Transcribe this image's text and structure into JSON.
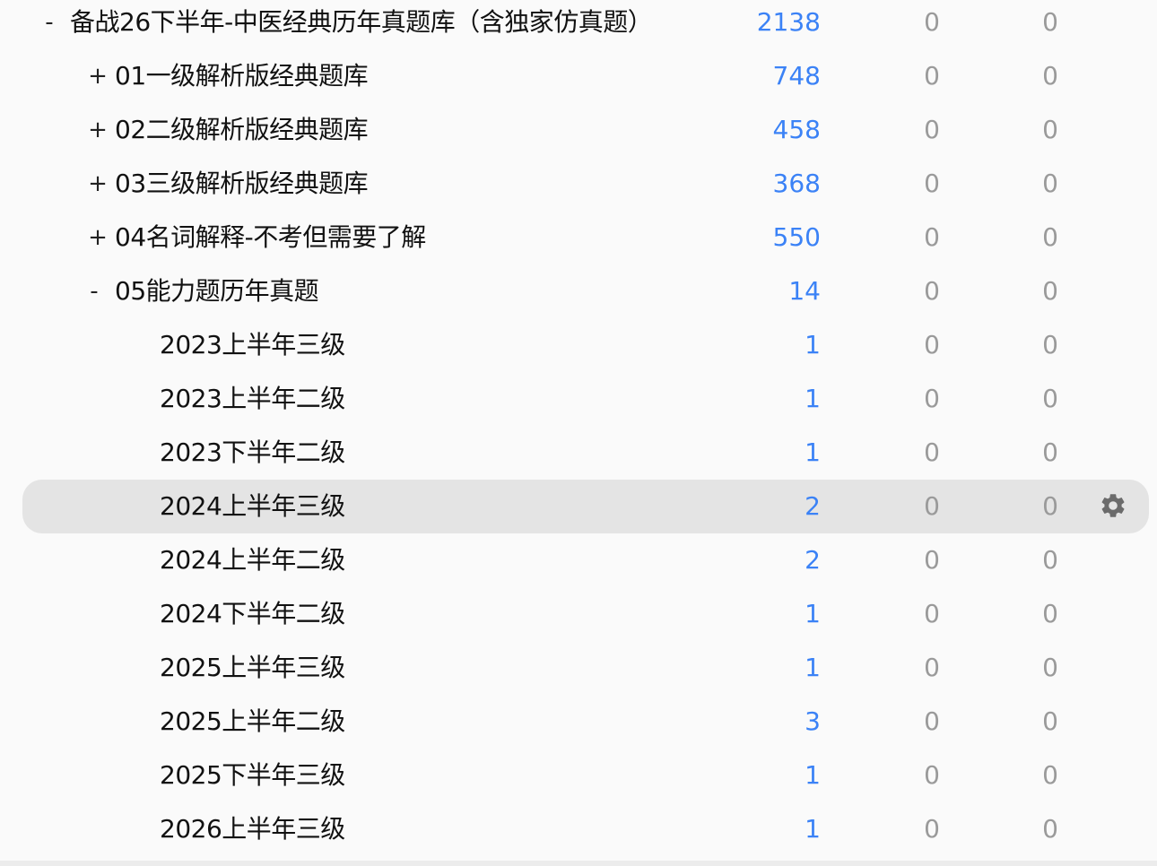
{
  "decks": [
    {
      "toggle": "-",
      "name": "备战26下半年-中医经典历年真题库（含独家仿真题）",
      "new": "2138",
      "learn": "0",
      "due": "0"
    },
    {
      "toggle": "+",
      "name": "01一级解析版经典题库",
      "new": "748",
      "learn": "0",
      "due": "0"
    },
    {
      "toggle": "+",
      "name": "02二级解析版经典题库",
      "new": "458",
      "learn": "0",
      "due": "0"
    },
    {
      "toggle": "+",
      "name": "03三级解析版经典题库",
      "new": "368",
      "learn": "0",
      "due": "0"
    },
    {
      "toggle": "+",
      "name": "04名词解释-不考但需要了解",
      "new": "550",
      "learn": "0",
      "due": "0"
    },
    {
      "toggle": "-",
      "name": "05能力题历年真题",
      "new": "14",
      "learn": "0",
      "due": "0"
    },
    {
      "toggle": "",
      "name": "2023上半年三级",
      "new": "1",
      "learn": "0",
      "due": "0"
    },
    {
      "toggle": "",
      "name": "2023上半年二级",
      "new": "1",
      "learn": "0",
      "due": "0"
    },
    {
      "toggle": "",
      "name": "2023下半年二级",
      "new": "1",
      "learn": "0",
      "due": "0"
    },
    {
      "toggle": "",
      "name": "2024上半年三级",
      "new": "2",
      "learn": "0",
      "due": "0",
      "selected": true
    },
    {
      "toggle": "",
      "name": "2024上半年二级",
      "new": "2",
      "learn": "0",
      "due": "0"
    },
    {
      "toggle": "",
      "name": "2024下半年二级",
      "new": "1",
      "learn": "0",
      "due": "0"
    },
    {
      "toggle": "",
      "name": "2025上半年三级",
      "new": "1",
      "learn": "0",
      "due": "0"
    },
    {
      "toggle": "",
      "name": "2025上半年二级",
      "new": "3",
      "learn": "0",
      "due": "0"
    },
    {
      "toggle": "",
      "name": "2025下半年三级",
      "new": "1",
      "learn": "0",
      "due": "0"
    },
    {
      "toggle": "",
      "name": "2026上半年三级",
      "new": "1",
      "learn": "0",
      "due": "0"
    }
  ],
  "icons": {
    "options": "gear-icon"
  },
  "colors": {
    "new_count": "#3b82f6",
    "zero_count": "#9a9a9a",
    "selected_row": "#e4e4e4",
    "background": "#fafafa"
  }
}
